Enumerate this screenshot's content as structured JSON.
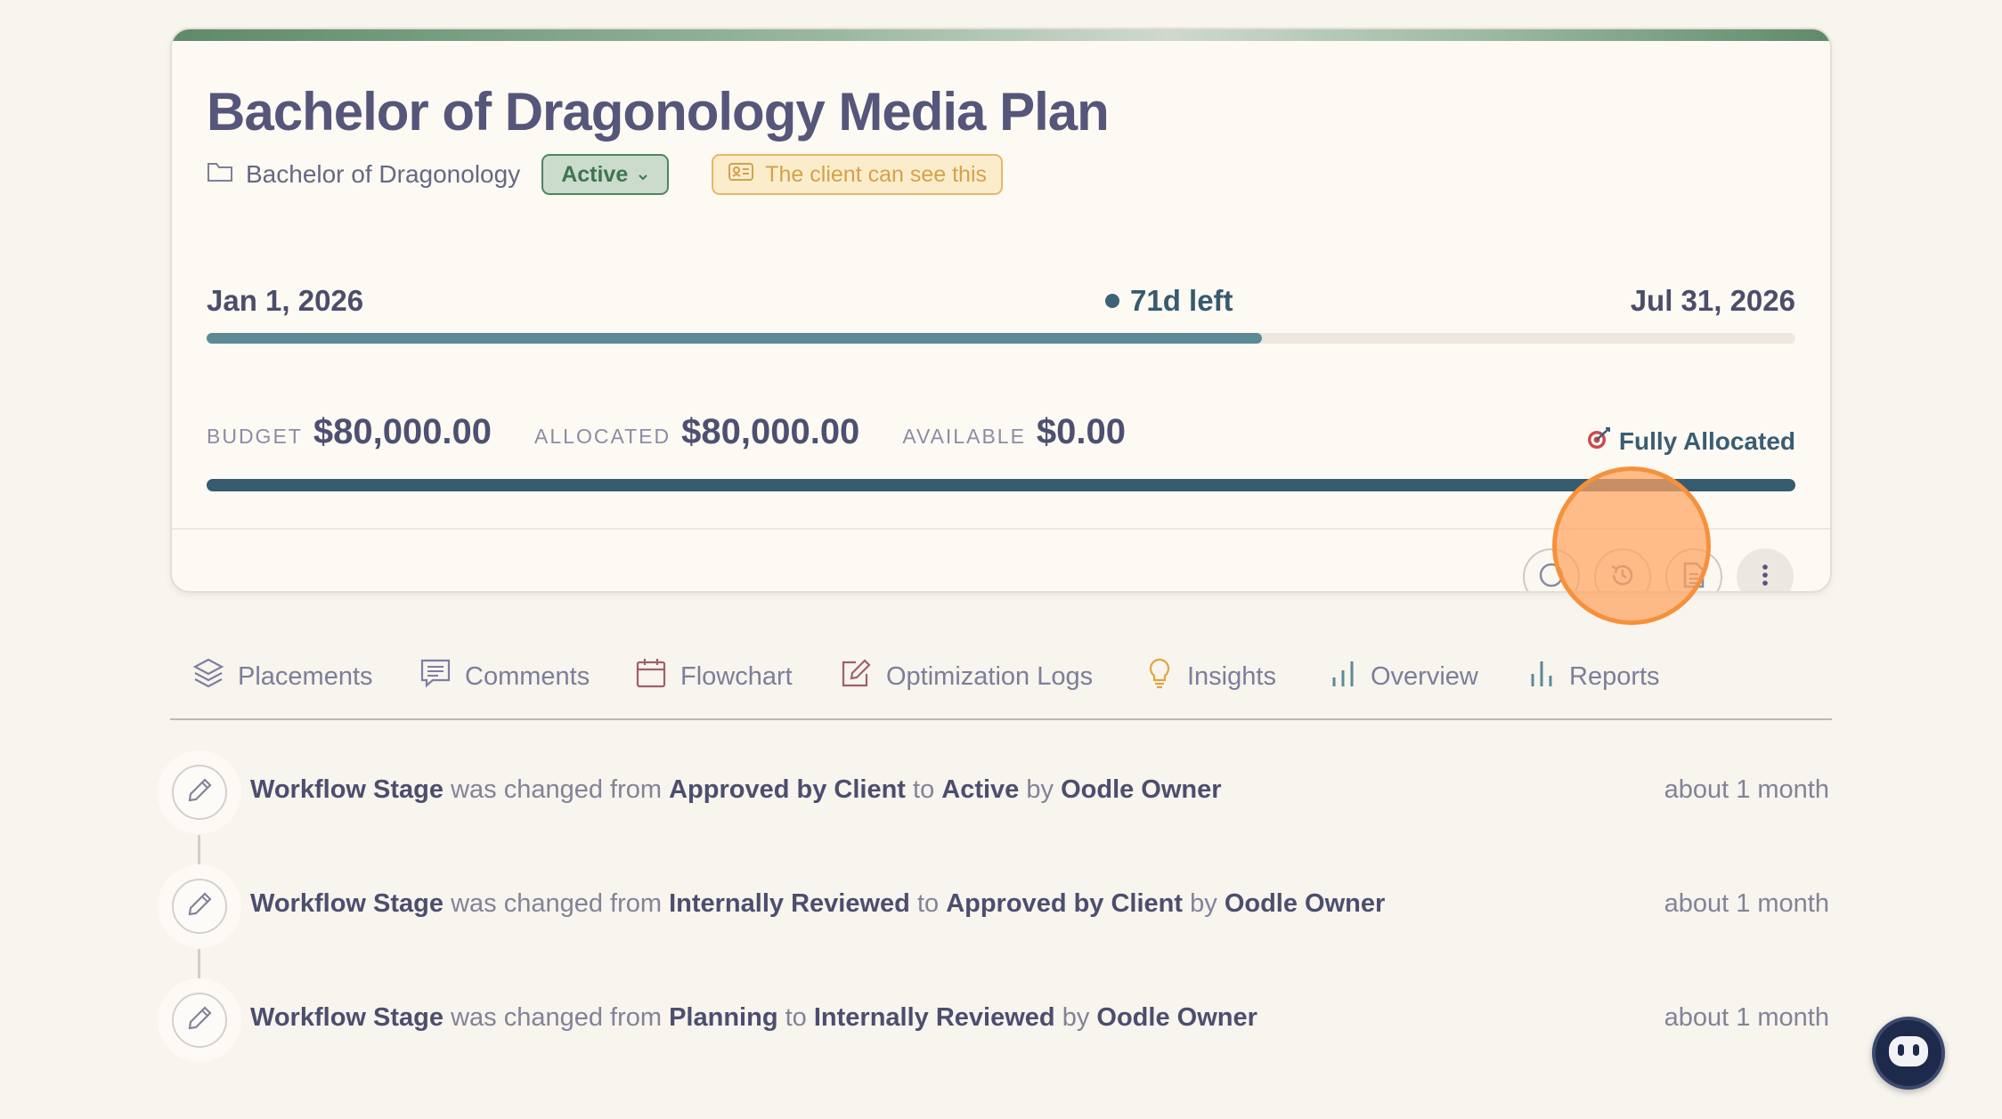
{
  "plan": {
    "title": "Bachelor of Dragonology Media Plan",
    "folder": "Bachelor of Dragonology",
    "status": "Active",
    "visibility": "The client can see this"
  },
  "timeline": {
    "start": "Jan 1, 2026",
    "remaining": "71d left",
    "end": "Jul 31, 2026",
    "elapsed_fraction": 0.664
  },
  "budget": {
    "budget_label": "BUDGET",
    "budget_value": "$80,000.00",
    "allocated_label": "ALLOCATED",
    "allocated_value": "$80,000.00",
    "available_label": "AVAILABLE",
    "available_value": "$0.00",
    "status": "Fully Allocated",
    "allocated_fraction": 1.0
  },
  "actions": {
    "icons": [
      "info-icon",
      "history-icon",
      "document-icon",
      "more-vertical-icon"
    ]
  },
  "tabs": [
    {
      "label": "Placements",
      "icon": "layers-icon"
    },
    {
      "label": "Comments",
      "icon": "comment-icon"
    },
    {
      "label": "Flowchart",
      "icon": "calendar-icon"
    },
    {
      "label": "Optimization Logs",
      "icon": "edit-icon"
    },
    {
      "label": "Insights",
      "icon": "lightbulb-icon"
    },
    {
      "label": "Overview",
      "icon": "bar-chart-icon"
    },
    {
      "label": "Reports",
      "icon": "bar-chart-icon"
    }
  ],
  "activity": [
    {
      "field": "Workflow Stage",
      "verb": "was changed from",
      "from": "Approved by Client",
      "to_word": "to",
      "to": "Active",
      "by_word": "by",
      "user": "Oodle Owner",
      "time": "about 1 month"
    },
    {
      "field": "Workflow Stage",
      "verb": "was changed from",
      "from": "Internally Reviewed",
      "to_word": "to",
      "to": "Approved by Client",
      "by_word": "by",
      "user": "Oodle Owner",
      "time": "about 1 month"
    },
    {
      "field": "Workflow Stage",
      "verb": "was changed from",
      "from": "Planning",
      "to_word": "to",
      "to": "Internally Reviewed",
      "by_word": "by",
      "user": "Oodle Owner",
      "time": "about 1 month"
    }
  ],
  "colors": {
    "accent_green": "#4e8562",
    "accent_teal": "#375c70",
    "highlight_orange": "#f6913b"
  }
}
